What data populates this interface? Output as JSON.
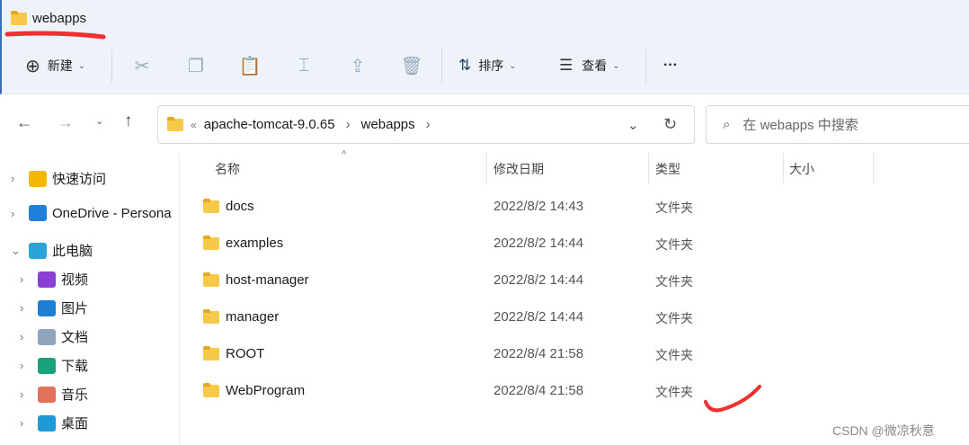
{
  "window": {
    "title": "webapps"
  },
  "toolbar": {
    "new_label": "新建",
    "sort_label": "排序",
    "view_label": "查看",
    "more_label": "···"
  },
  "address": {
    "overflow": "«",
    "segments": [
      "apache-tomcat-9.0.65",
      "webapps"
    ]
  },
  "search": {
    "placeholder": "在 webapps 中搜索"
  },
  "sidebar": {
    "items": [
      {
        "label": "快速访问",
        "color": "#f6b700"
      },
      {
        "label": "OneDrive - Persona",
        "color": "#1f7fd8"
      },
      {
        "label": "此电脑",
        "color": "#2aa3d6"
      },
      {
        "label": "视频",
        "color": "#8a3fd6"
      },
      {
        "label": "图片",
        "color": "#1c7fd4"
      },
      {
        "label": "文档",
        "color": "#8fa5be"
      },
      {
        "label": "下载",
        "color": "#1aa37a"
      },
      {
        "label": "音乐",
        "color": "#e2735a"
      },
      {
        "label": "桌面",
        "color": "#1e9bd6"
      }
    ]
  },
  "columns": {
    "name": "名称",
    "modified": "修改日期",
    "type": "类型",
    "size": "大小"
  },
  "files": [
    {
      "name": "docs",
      "modified": "2022/8/2 14:43",
      "type": "文件夹"
    },
    {
      "name": "examples",
      "modified": "2022/8/2 14:44",
      "type": "文件夹"
    },
    {
      "name": "host-manager",
      "modified": "2022/8/2 14:44",
      "type": "文件夹"
    },
    {
      "name": "manager",
      "modified": "2022/8/2 14:44",
      "type": "文件夹"
    },
    {
      "name": "ROOT",
      "modified": "2022/8/4 21:58",
      "type": "文件夹"
    },
    {
      "name": "WebProgram",
      "modified": "2022/8/4 21:58",
      "type": "文件夹"
    }
  ],
  "watermark": "CSDN @微凉秋意"
}
